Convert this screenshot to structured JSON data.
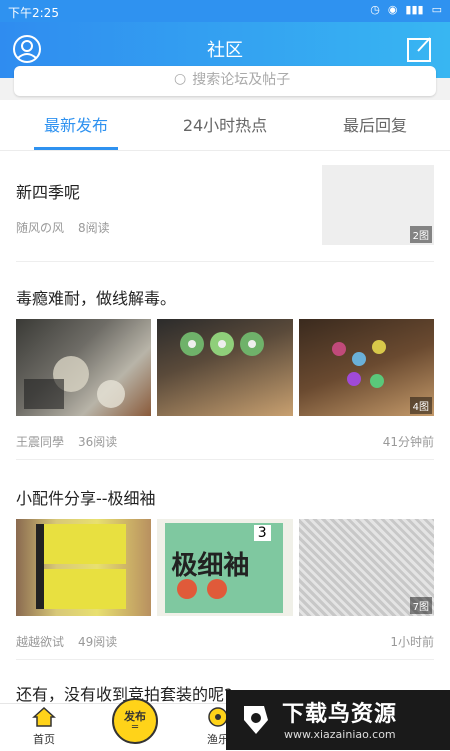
{
  "status": {
    "time": "下午2:25"
  },
  "header": {
    "title": "社区"
  },
  "search": {
    "placeholder": "搜索论坛及帖子"
  },
  "tabs": [
    {
      "label": "最新发布",
      "active": true
    },
    {
      "label": "24小时热点",
      "active": false
    },
    {
      "label": "最后回复",
      "active": false
    }
  ],
  "posts": [
    {
      "title": "新四季呢",
      "author": "随风の风",
      "reads": "8阅读",
      "img_count": "2图",
      "time": ""
    },
    {
      "title": "毒瘾难耐，做线解毒。",
      "author": "王震同學",
      "reads": "36阅读",
      "time": "41分钟前",
      "img_count": "4图"
    },
    {
      "title": "小配件分享--极细袖",
      "author": "越越欲试",
      "reads": "49阅读",
      "time": "1小时前",
      "img_count": "7图",
      "image_text": {
        "big": "极细袖",
        "num": "3"
      }
    },
    {
      "title": "还有，没有收到竞拍套装的呢?"
    }
  ],
  "bottom_nav": {
    "home": "首页",
    "publish": "发布",
    "fish": "渔乐"
  },
  "watermark": {
    "big": "下载鸟资源",
    "small": "www.xiazainiao.com"
  },
  "colors": {
    "primary": "#2f92f0",
    "accent_yellow": "#ffd319"
  }
}
